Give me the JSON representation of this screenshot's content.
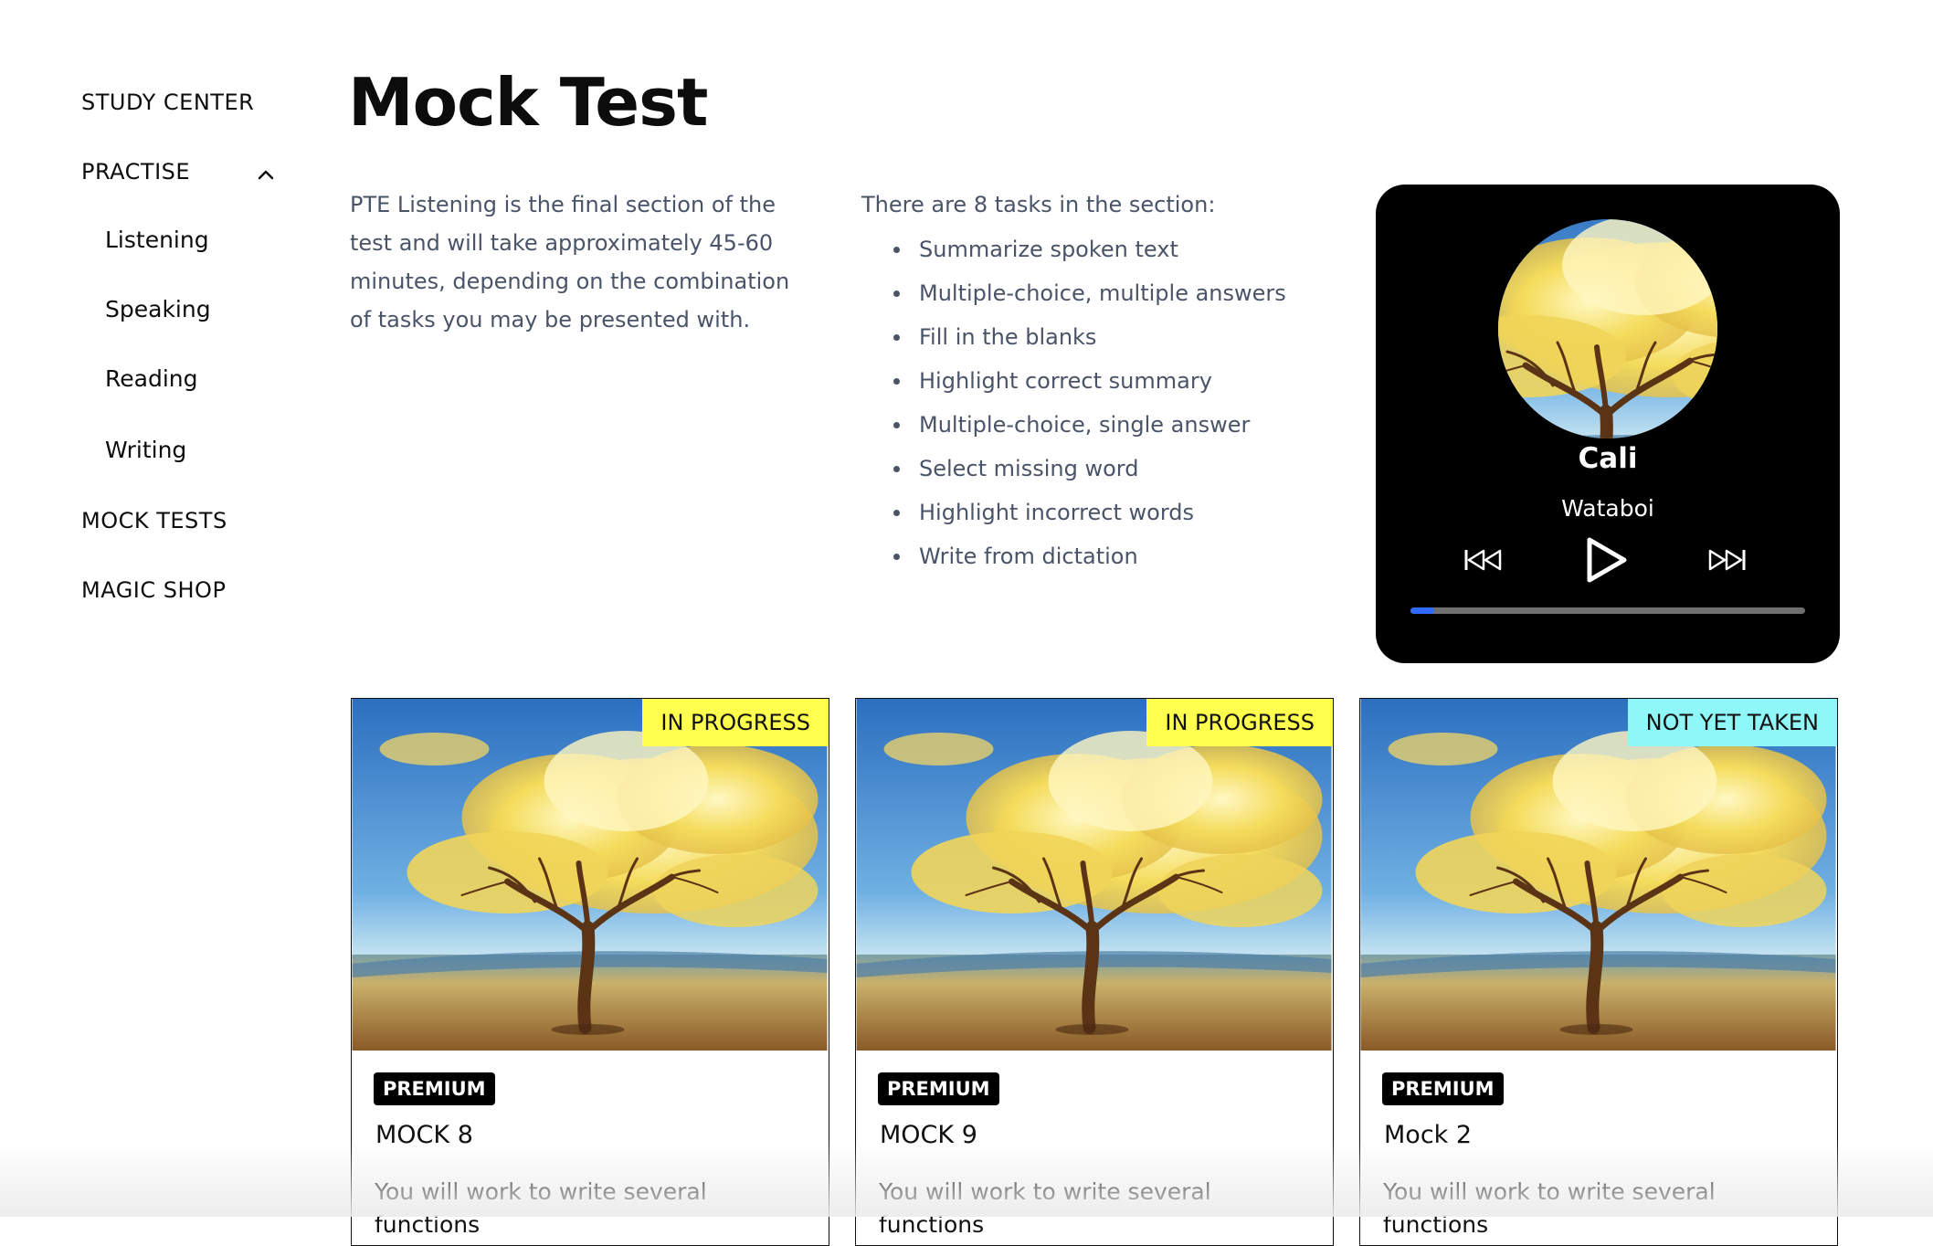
{
  "sidebar": {
    "study_center": "STUDY CENTER",
    "practise": "PRACTISE",
    "sub_items": [
      "Listening",
      "Speaking",
      "Reading",
      "Writing"
    ],
    "mock_tests": "MOCK TESTS",
    "magic_shop": "MAGIC SHOP"
  },
  "page": {
    "title": "Mock Test",
    "intro": "PTE Listening is the final section of the test and will take approximately 45-60 minutes, depending on the combination of tasks you may be presented with.",
    "tasks_heading": "There are 8 tasks in the section:",
    "tasks": [
      "Summarize spoken text",
      "Multiple-choice, multiple answers",
      "Fill in the blanks",
      "Highlight correct summary",
      "Multiple-choice, single answer",
      "Select missing word",
      "Highlight incorrect words",
      "Write from dictation"
    ]
  },
  "player": {
    "title": "Cali",
    "artist": "Wataboi",
    "progress": 0.06,
    "progress_color": "#2f6bff"
  },
  "cards": [
    {
      "status": "IN PROGRESS",
      "status_color": "#ffff4d",
      "badge": "PREMIUM",
      "title": "MOCK 8",
      "description": "You will work to write several functions"
    },
    {
      "status": "IN PROGRESS",
      "status_color": "#ffff4d",
      "badge": "PREMIUM",
      "title": "MOCK 9",
      "description": "You will work to write several functions"
    },
    {
      "status": "NOT YET TAKEN",
      "status_color": "#8ff7f7",
      "badge": "PREMIUM",
      "title": "Mock 2",
      "description": "You will work to write several functions"
    }
  ]
}
